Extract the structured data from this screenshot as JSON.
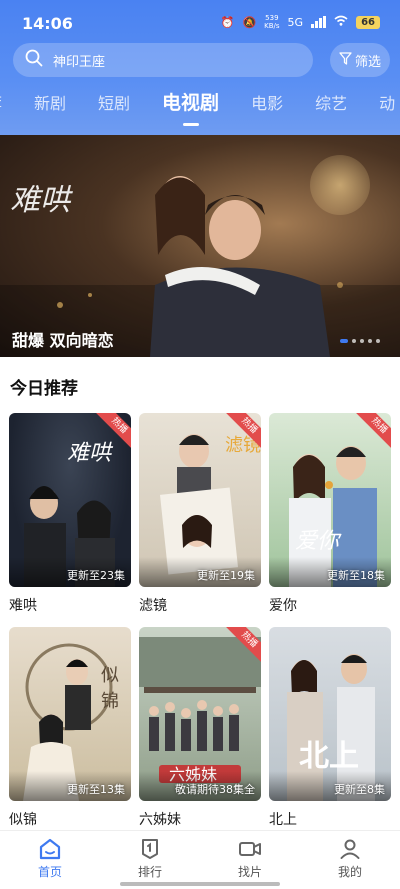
{
  "status": {
    "time": "14:06",
    "net_speed": "539",
    "net_unit": "KB/s",
    "signal": "5G",
    "battery": "66"
  },
  "search": {
    "placeholder": "神印王座",
    "filter_label": "筛选"
  },
  "tabs": [
    {
      "label": "荐"
    },
    {
      "label": "新剧"
    },
    {
      "label": "短剧"
    },
    {
      "label": "电视剧"
    },
    {
      "label": "电影"
    },
    {
      "label": "综艺"
    },
    {
      "label": "动"
    }
  ],
  "active_tab": "电视剧",
  "banner": {
    "logo_text": "难哄",
    "caption": "甜爆 双向暗恋",
    "slide_count": 5,
    "active_slide": 0
  },
  "section": {
    "title": "今日推荐"
  },
  "cards": [
    {
      "name": "难哄",
      "episodes": "更新至23集",
      "hot": "热播",
      "poster_text": "难哄"
    },
    {
      "name": "滤镜",
      "episodes": "更新至19集",
      "hot": "热播",
      "poster_text": "滤镜"
    },
    {
      "name": "爱你",
      "episodes": "更新至18集",
      "hot": "热播",
      "poster_text": "爱你"
    },
    {
      "name": "似锦",
      "episodes": "更新至13集",
      "hot": "",
      "poster_text": "似锦"
    },
    {
      "name": "六姊妹",
      "episodes": "敬请期待38集全",
      "hot": "热播",
      "poster_text": "六姊妹"
    },
    {
      "name": "北上",
      "episodes": "更新至8集",
      "hot": "",
      "poster_text": "北上"
    }
  ],
  "nav": [
    {
      "label": "首页",
      "icon": "home-icon"
    },
    {
      "label": "排行",
      "icon": "rank-icon"
    },
    {
      "label": "找片",
      "icon": "video-icon"
    },
    {
      "label": "我的",
      "icon": "profile-icon"
    }
  ],
  "colors": {
    "accent": "#3f7af0",
    "header": "#4a82f2",
    "hot_badge": "#e24c4c"
  }
}
